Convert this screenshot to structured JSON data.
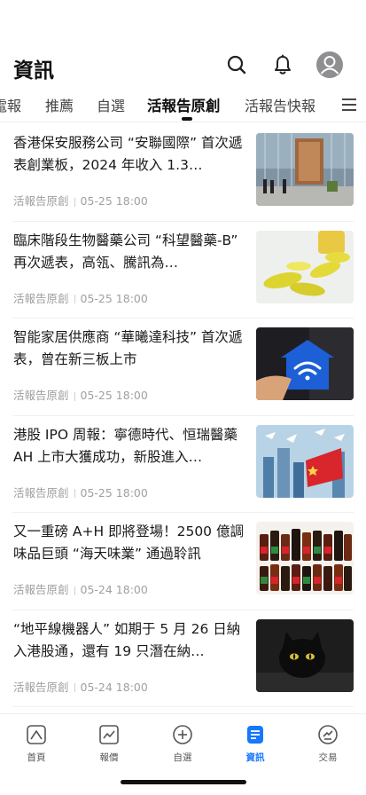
{
  "header": {
    "title": "資訊"
  },
  "tabs": [
    {
      "label": "電報"
    },
    {
      "label": "推薦"
    },
    {
      "label": "自選"
    },
    {
      "label": "活報告原創"
    },
    {
      "label": "活報告快報"
    }
  ],
  "active_tab_index": 3,
  "articles": [
    {
      "title": "香港保安服務公司 “安聯國際” 首次遞表創業板，2024 年收入 1.3…",
      "source": "活報告原創",
      "time": "05-25 18:00",
      "thumb": "building-lobby-image"
    },
    {
      "title": "臨床階段生物醫藥公司 “科望醫藥-B” 再次遞表，高瓴、騰訊為…",
      "source": "活報告原創",
      "time": "05-25 18:00",
      "thumb": "pills-image"
    },
    {
      "title": "智能家居供應商 “華曦達科技” 首次遞表，曾在新三板上市",
      "source": "活報告原創",
      "time": "05-25 18:00",
      "thumb": "wifi-house-image"
    },
    {
      "title": "港股 IPO 周報：寧德時代、恒瑞醫藥 AH 上市大獲成功，新股進入…",
      "source": "活報告原創",
      "time": "05-25 18:00",
      "thumb": "city-flag-image"
    },
    {
      "title": "又一重磅 A+H 即將登場！2500 億調味品巨頭 “海天味業” 通過聆訊",
      "source": "活報告原創",
      "time": "05-24 18:00",
      "thumb": "sauce-bottles-image"
    },
    {
      "title": "“地平線機器人” 如期于 5 月 26 日納入港股通，還有 19 只潛在納…",
      "source": "活報告原創",
      "time": "05-24 18:00",
      "thumb": "black-cat-image"
    }
  ],
  "bottom_nav": [
    {
      "label": "首頁",
      "icon": "home-icon"
    },
    {
      "label": "報價",
      "icon": "chart-icon"
    },
    {
      "label": "自選",
      "icon": "plus-circle-icon"
    },
    {
      "label": "資訊",
      "icon": "news-icon"
    },
    {
      "label": "交易",
      "icon": "trade-icon"
    }
  ],
  "active_nav_index": 3,
  "colors": {
    "accent": "#1677ff",
    "text": "#1a1a1a",
    "meta": "#a0a0a0"
  }
}
